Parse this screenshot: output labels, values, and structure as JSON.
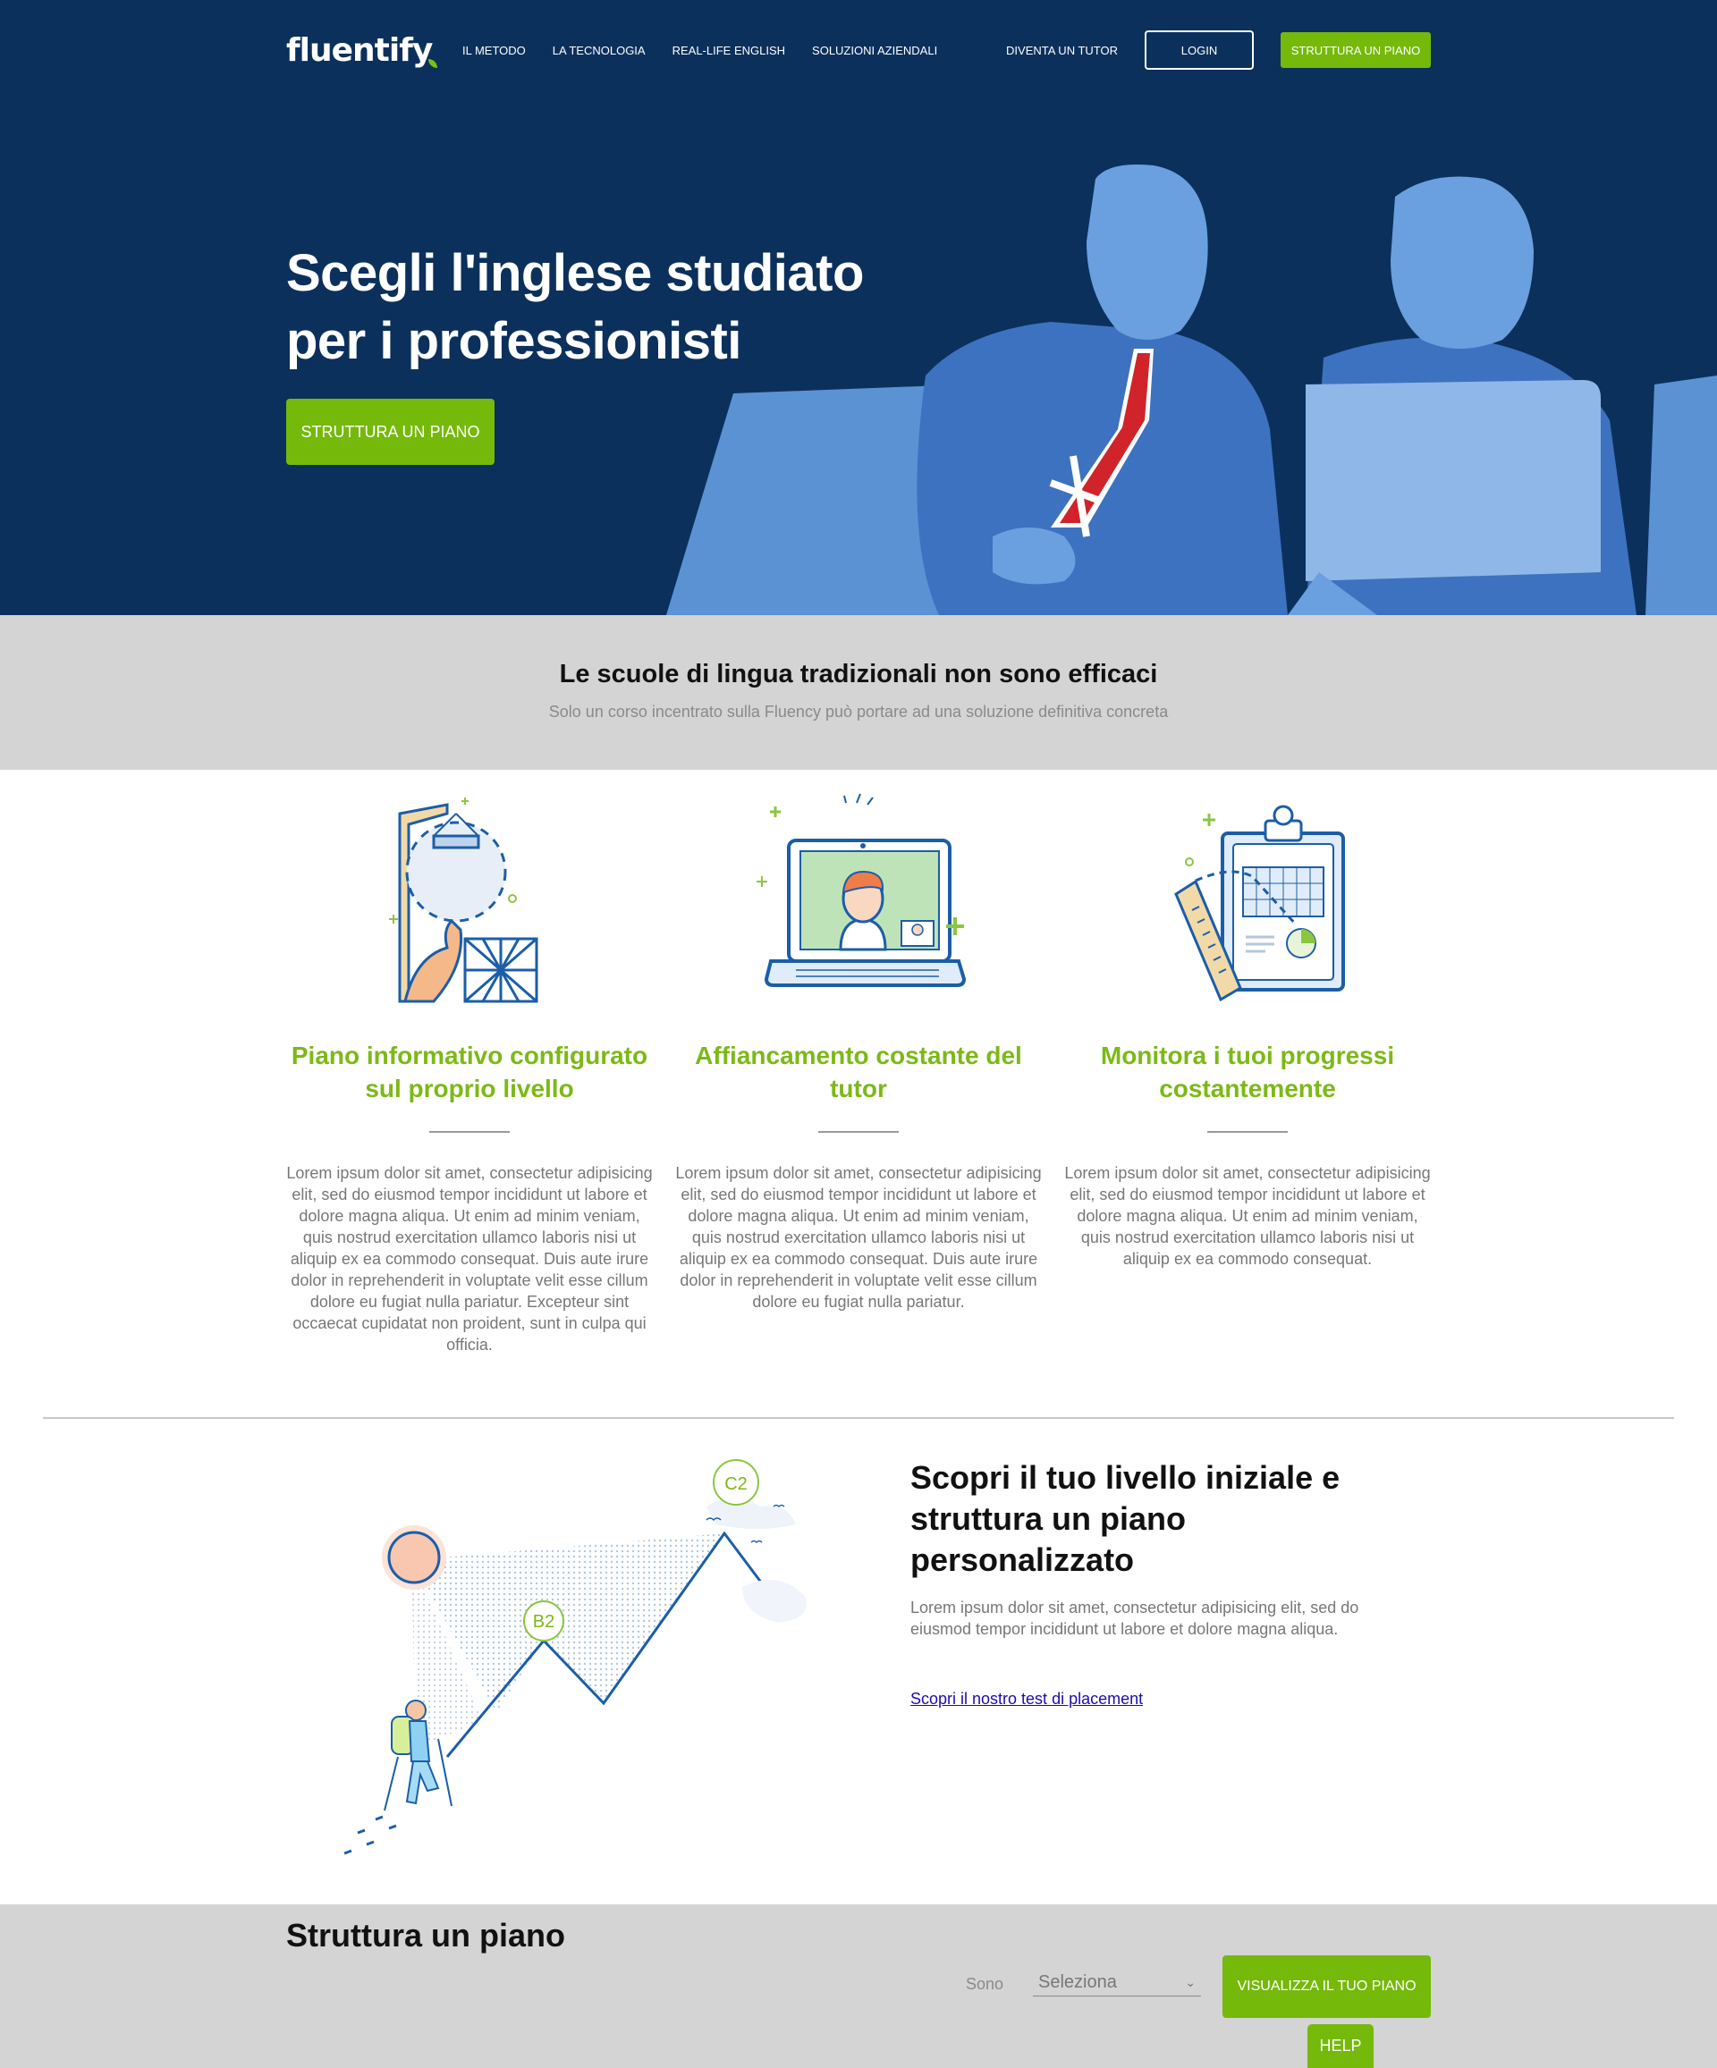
{
  "header": {
    "logo_text": "fluentify",
    "nav": [
      "IL METODO",
      "LA TECNOLOGIA",
      "REAL-LIFE ENGLISH",
      "SOLUZIONI AZIENDALI"
    ],
    "tutor_link": "DIVENTA UN TUTOR",
    "login_label": "LOGIN",
    "plan_button_label": "STRUTTURA UN PIANO"
  },
  "hero": {
    "title_line1": "Scegli l'inglese studiato",
    "title_line2": "per i professionisti",
    "cta_label": "STRUTTURA UN PIANO"
  },
  "band": {
    "title": "Le scuole di lingua tradizionali non sono efficaci",
    "subtitle": "Solo un corso incentrato sulla Fluency può portare ad una soluzione definitiva concreta"
  },
  "features": [
    {
      "icon": "construction-head-icon",
      "title": "Piano informativo configurato sul proprio livello",
      "text": "Lorem ipsum dolor sit amet, consectetur adipisicing elit, sed do eiusmod tempor incididunt ut labore et dolore magna aliqua. Ut enim ad minim veniam, quis nostrud exercitation ullamco laboris nisi ut aliquip ex ea commodo consequat. Duis aute irure dolor in reprehenderit in voluptate velit esse cillum dolore eu fugiat nulla pariatur. Excepteur sint occaecat cupidatat non proident, sunt in culpa qui officia."
    },
    {
      "icon": "video-call-laptop-icon",
      "title": "Affiancamento costante del tutor",
      "text": "Lorem ipsum dolor sit amet, consectetur adipisicing elit, sed do eiusmod tempor incididunt ut labore et dolore magna aliqua. Ut enim ad minim veniam, quis nostrud exercitation ullamco laboris nisi ut aliquip ex ea commodo consequat. Duis aute irure dolor in reprehenderit in voluptate velit esse cillum dolore eu fugiat nulla pariatur."
    },
    {
      "icon": "clipboard-progress-icon",
      "title": "Monitora i tuoi progressi costantemente",
      "text": "Lorem ipsum dolor sit amet, consectetur adipisicing elit, sed do eiusmod tempor incididunt ut labore et dolore magna aliqua. Ut enim ad minim veniam, quis nostrud exercitation ullamco laboris nisi ut aliquip ex ea commodo consequat."
    }
  ],
  "placement": {
    "title": "Scopri il tuo livello iniziale e struttura un piano personalizzato",
    "text": "Lorem ipsum dolor sit amet, consectetur adipisicing elit, sed do eiusmod tempor incididunt ut labore et dolore magna aliqua.",
    "link": "Scopri il nostro test di placement",
    "level_low": "B2",
    "level_high": "C2"
  },
  "footer": {
    "title": "Struttura un piano",
    "sono_label": "Sono",
    "select_value": "Seleziona",
    "button_label": "VISUALIZZA IL TUO PIANO",
    "help_label": "HELP"
  },
  "colors": {
    "hero_bg": "#0c305c",
    "accent_green": "#75b90b",
    "band_grey": "#d4d4d4",
    "figure_blue": "#5f95d6"
  }
}
